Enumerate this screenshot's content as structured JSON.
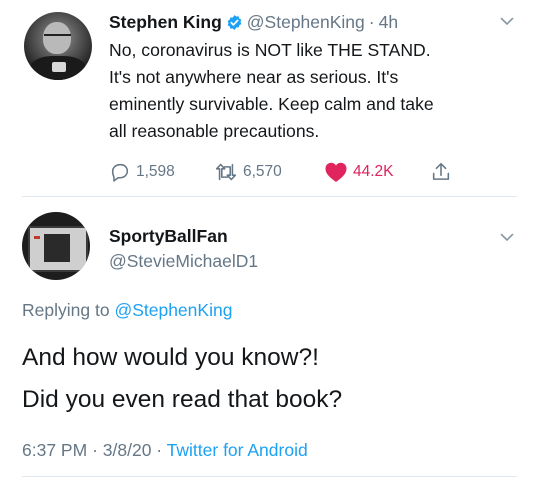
{
  "tweet": {
    "author_name": "Stephen King",
    "author_handle": "@StephenKing",
    "separator": "·",
    "time": "4h",
    "lines": [
      "No, coronavirus is NOT like THE STAND.",
      "It's not anywhere near as serious. It's",
      "eminently survivable. Keep calm and take",
      "all reasonable precautions."
    ],
    "stats": {
      "replies": "1,598",
      "retweets": "6,570",
      "likes": "44.2K"
    },
    "icons": {
      "verified": "verified-badge-icon",
      "reply": "reply-icon",
      "retweet": "retweet-icon",
      "like": "heart-icon",
      "share": "share-icon",
      "more": "chevron-down-icon"
    }
  },
  "reply": {
    "author_name": "SportyBallFan",
    "author_handle": "@StevieMichaelD1",
    "replying_prefix": "Replying to",
    "replying_to": "@StephenKing",
    "lines": [
      "And how would you know?!",
      "Did you even read that book?"
    ],
    "time": "6:37 PM",
    "separator": "·",
    "date": "3/8/20",
    "source": "Twitter for Android"
  },
  "colors": {
    "text": "#14171a",
    "muted": "#657786",
    "link": "#1da1f2",
    "like": "#e0245e",
    "verified": "#1da1f2",
    "divider": "#e1e8ed"
  }
}
